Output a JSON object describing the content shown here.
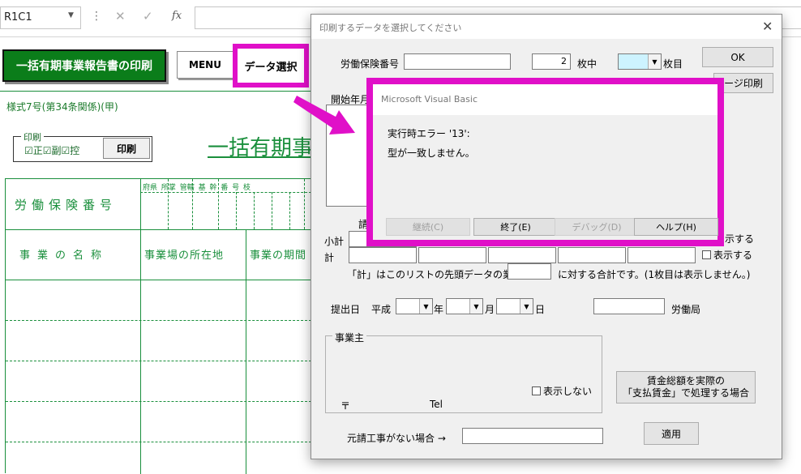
{
  "formula_bar": {
    "name_box": "R1C1",
    "fx": "fx"
  },
  "sheet": {
    "main_button": "一括有期事業報告書の印刷",
    "menu_button": "MENU",
    "data_select_button": "データ選択",
    "form_label": "様式7号(第34条関係)(甲)",
    "print_group_title": "印刷",
    "print_checks": "☑正☑副☑控",
    "print_button": "印刷",
    "title": "一括有期事",
    "grid_label_1": "労働保険番号",
    "grid_label_2": "事業の名称",
    "grid_label_3": "事業場の所在地",
    "grid_label_4": "事業の期間",
    "grid_small_headers": "府県 所掌 管轄 基 幹 番 号 枝"
  },
  "dialog": {
    "title": "印刷するデータを選択してください",
    "labour_insurance_no_label": "労働保険番号",
    "sheet_count": "2",
    "sheet_count_label": "枚中",
    "sheet_index_label": "枚目",
    "ok_button": "OK",
    "page_print_button": "ージ印刷",
    "start_label": "開始年月",
    "ukeoi_label": "請",
    "subtotal_label": "小計",
    "total_label": "計",
    "show_label_1": "示する",
    "show_label_2": "表示する",
    "note_prefix": "「計」はこのリストの先頭データの業種番号",
    "note_suffix": "に対する合計です。(1枚目は表示しません。)",
    "submit_label": "提出日",
    "era_label": "平成",
    "year_label": "年",
    "month_label": "月",
    "day_label": "日",
    "labour_bureau_label": "労働局",
    "employer_group": "事業主",
    "postal_mark": "〒",
    "tel_label": "Tel",
    "hide_label": "表示しない",
    "wage_button_line1": "賃金総額を実際の",
    "wage_button_line2": "「支払賃金」で処理する場合",
    "no_prime_label": "元請工事がない場合 →",
    "apply_button": "適用"
  },
  "error_box": {
    "title": "Microsoft Visual Basic",
    "line1": "実行時エラー '13':",
    "line2": "型が一致しません。",
    "buttons": [
      "継続(C)",
      "終了(E)",
      "デバッグ(D)",
      "ヘルプ(H)"
    ]
  },
  "colors": {
    "highlight": "#e010c8",
    "excel_green": "#1a8f3c",
    "main_button": "#0b7d1a",
    "index_field": "#cdf3ff"
  }
}
